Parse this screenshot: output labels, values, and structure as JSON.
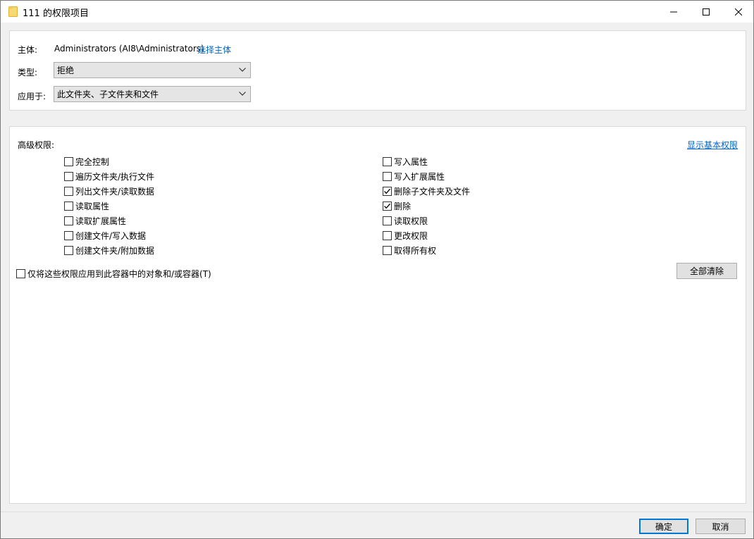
{
  "window": {
    "title": "111 的权限项目"
  },
  "principal": {
    "label": "主体:",
    "value": "Administrators (AI8\\Administrators)",
    "select_link": "选择主体"
  },
  "type_field": {
    "label": "类型:",
    "value": "拒绝"
  },
  "applies_to": {
    "label": "应用于:",
    "value": "此文件夹、子文件夹和文件"
  },
  "advanced": {
    "heading": "高级权限:",
    "show_basic_link": "显示基本权限",
    "left_column": [
      {
        "label": "完全控制",
        "checked": false
      },
      {
        "label": "遍历文件夹/执行文件",
        "checked": false
      },
      {
        "label": "列出文件夹/读取数据",
        "checked": false
      },
      {
        "label": "读取属性",
        "checked": false
      },
      {
        "label": "读取扩展属性",
        "checked": false
      },
      {
        "label": "创建文件/写入数据",
        "checked": false
      },
      {
        "label": "创建文件夹/附加数据",
        "checked": false
      }
    ],
    "right_column": [
      {
        "label": "写入属性",
        "checked": false
      },
      {
        "label": "写入扩展属性",
        "checked": false
      },
      {
        "label": "删除子文件夹及文件",
        "checked": true
      },
      {
        "label": "删除",
        "checked": true
      },
      {
        "label": "读取权限",
        "checked": false
      },
      {
        "label": "更改权限",
        "checked": false
      },
      {
        "label": "取得所有权",
        "checked": false
      }
    ],
    "apply_only_label": "仅将这些权限应用到此容器中的对象和/或容器(T)",
    "apply_only_checked": false,
    "clear_all_button": "全部清除"
  },
  "footer": {
    "ok_button": "确定",
    "cancel_button": "取消"
  },
  "colors": {
    "link": "#0066cc",
    "default_button_border": "#0078d7",
    "dialog_bg": "#f0f0f0"
  }
}
